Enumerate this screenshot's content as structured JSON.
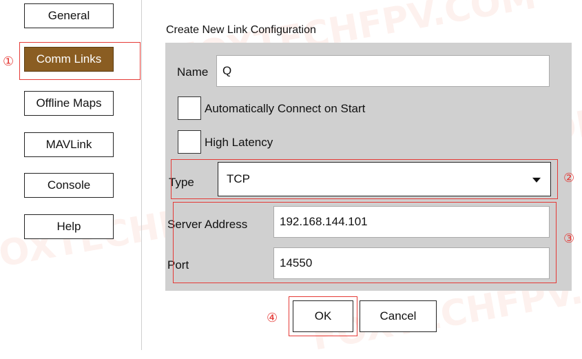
{
  "sidebar": {
    "items": [
      {
        "label": "General",
        "active": false
      },
      {
        "label": "Comm Links",
        "active": true
      },
      {
        "label": "Offline Maps",
        "active": false
      },
      {
        "label": "MAVLink",
        "active": false
      },
      {
        "label": "Console",
        "active": false
      },
      {
        "label": "Help",
        "active": false
      }
    ]
  },
  "callouts": {
    "c1": "①",
    "c2": "②",
    "c3": "③",
    "c4": "④"
  },
  "form": {
    "title": "Create New Link Configuration",
    "name_label": "Name",
    "name_value": "Q",
    "auto_connect_label": "Automatically Connect on Start",
    "auto_connect_checked": false,
    "high_latency_label": "High Latency",
    "high_latency_checked": false,
    "type_label": "Type",
    "type_value": "TCP",
    "server_address_label": "Server Address",
    "server_address_value": "192.168.144.101",
    "port_label": "Port",
    "port_value": "14550"
  },
  "actions": {
    "ok_label": "OK",
    "cancel_label": "Cancel"
  },
  "watermark": {
    "text": "FOXTECHFPV.COM"
  },
  "colors": {
    "active_nav": "#8a5d22",
    "annotation_red": "#e53935",
    "panel_bg": "#d0d0d0"
  }
}
